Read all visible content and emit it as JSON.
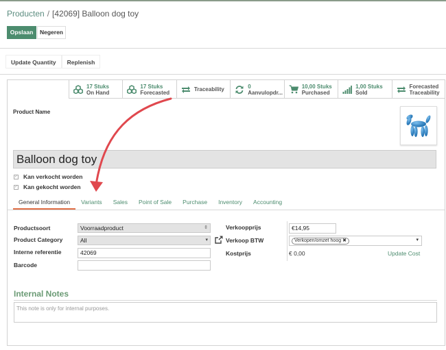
{
  "breadcrumb": {
    "parent": "Producten",
    "separator": "/",
    "current": "[42069] Balloon dog toy"
  },
  "buttons": {
    "save": "Opslaan",
    "discard": "Negeren"
  },
  "actions": [
    "Update Quantity",
    "Replenish"
  ],
  "stats": [
    {
      "icon": "cubes-icon",
      "num": "17 Stuks",
      "label": "On Hand"
    },
    {
      "icon": "cubes-icon",
      "num": "17 Stuks",
      "label": "Forecasted"
    },
    {
      "icon": "exchange-icon",
      "num": "",
      "label": "Traceability"
    },
    {
      "icon": "refresh-icon",
      "num": "0",
      "label": "Aanvulopdr..."
    },
    {
      "icon": "cart-icon",
      "num": "10,00 Stuks",
      "label": "Purchased"
    },
    {
      "icon": "signal-icon",
      "num": "1,00 Stuks",
      "label": "Sold"
    },
    {
      "icon": "exchange-icon",
      "num": "Forecasted",
      "label": "Traceability"
    }
  ],
  "product": {
    "name_label": "Product Name",
    "name": "Balloon dog toy",
    "can_be_sold": "Kan verkocht worden",
    "can_be_purchased": "Kan gekocht worden",
    "can_be_sold_checked": true,
    "can_be_purchased_checked": true
  },
  "tabs": [
    "General Information",
    "Variants",
    "Sales",
    "Point of Sale",
    "Purchase",
    "Inventory",
    "Accounting"
  ],
  "form": {
    "type_label": "Productsoort",
    "type_value": "Voorraadproduct",
    "category_label": "Product Category",
    "category_value": "All",
    "ref_label": "Interne referentie",
    "ref_value": "42069",
    "barcode_label": "Barcode",
    "barcode_value": "",
    "price_label": "Verkoopprijs",
    "price_value": "€14,95",
    "tax_label": "Verkoop BTW",
    "tax_tag": "Verkopen/omzet hoog",
    "cost_label": "Kostprijs",
    "cost_value": "€ 0,00",
    "update_cost": "Update Cost"
  },
  "notes": {
    "title": "Internal Notes",
    "placeholder": "This note is only for internal purposes."
  },
  "colors": {
    "accent": "#4c8c6e",
    "tab_active": "#e06d45",
    "annotation_arrow": "#e0484e"
  }
}
